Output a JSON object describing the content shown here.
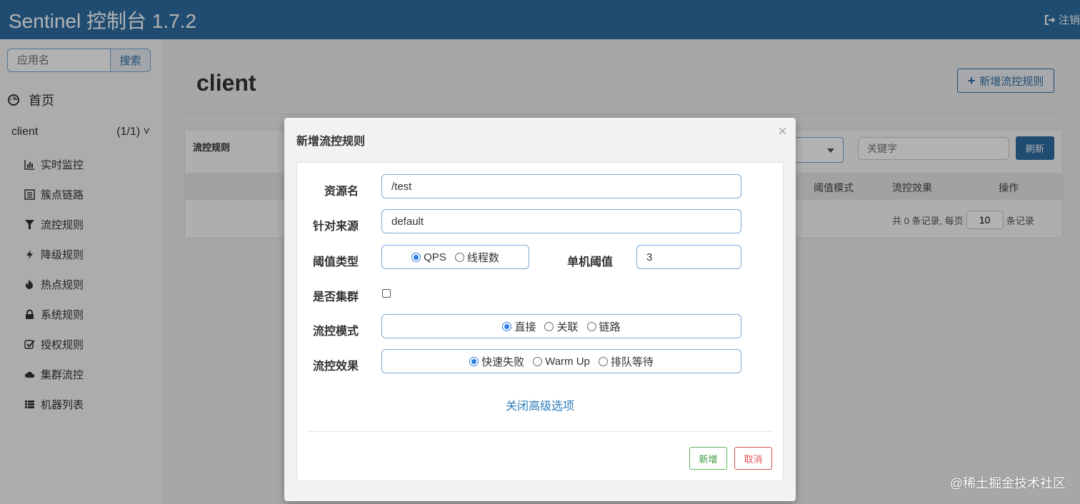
{
  "header": {
    "brand": "Sentinel 控制台 1.7.2",
    "logout_label": "注销",
    "logout_icon": "sign-out-icon"
  },
  "sidebar": {
    "search_placeholder": "应用名",
    "search_button": "搜索",
    "home_label": "首页",
    "app_name": "client",
    "app_count": "(1/1)",
    "menu": [
      {
        "label": "实时监控",
        "icon": "bar-chart-icon"
      },
      {
        "label": "簇点链路",
        "icon": "list-icon"
      },
      {
        "label": "流控规则",
        "icon": "filter-icon"
      },
      {
        "label": "降级规则",
        "icon": "flash-icon"
      },
      {
        "label": "热点规则",
        "icon": "fire-icon"
      },
      {
        "label": "系统规则",
        "icon": "lock-icon"
      },
      {
        "label": "授权规则",
        "icon": "check-square-icon"
      },
      {
        "label": "集群流控",
        "icon": "cloud-icon"
      },
      {
        "label": "机器列表",
        "icon": "th-list-icon"
      }
    ]
  },
  "main": {
    "title": "client",
    "add_rule_button": "新增流控规则",
    "panel_title": "流控规则",
    "keyword_placeholder": "关键字",
    "refresh_button": "刷新",
    "columns": [
      "阈值模式",
      "流控效果",
      "操作"
    ],
    "pager_prefix": "共 0 条记录, 每页",
    "page_size": "10",
    "pager_suffix": "条记录"
  },
  "modal": {
    "title": "新增流控规则",
    "close": "×",
    "resource_label": "资源名",
    "resource_value": "/test",
    "origin_label": "针对来源",
    "origin_value": "default",
    "threshold_type_label": "阈值类型",
    "threshold_type_options": [
      "QPS",
      "线程数"
    ],
    "threshold_type_selected": "QPS",
    "single_threshold_label": "单机阈值",
    "single_threshold_value": "3",
    "cluster_label": "是否集群",
    "cluster_checked": false,
    "mode_label": "流控模式",
    "mode_options": [
      "直接",
      "关联",
      "链路"
    ],
    "mode_selected": "直接",
    "effect_label": "流控效果",
    "effect_options": [
      "快速失败",
      "Warm Up",
      "排队等待"
    ],
    "effect_selected": "快速失败",
    "advanced_link": "关闭高级选项",
    "add_button": "新增",
    "cancel_button": "取消"
  },
  "watermark": "@稀土掘金技术社区",
  "colors": {
    "header": "#2f6da4",
    "accent": "#2b7ae0",
    "success": "#5cb85c",
    "danger": "#d9534f"
  }
}
